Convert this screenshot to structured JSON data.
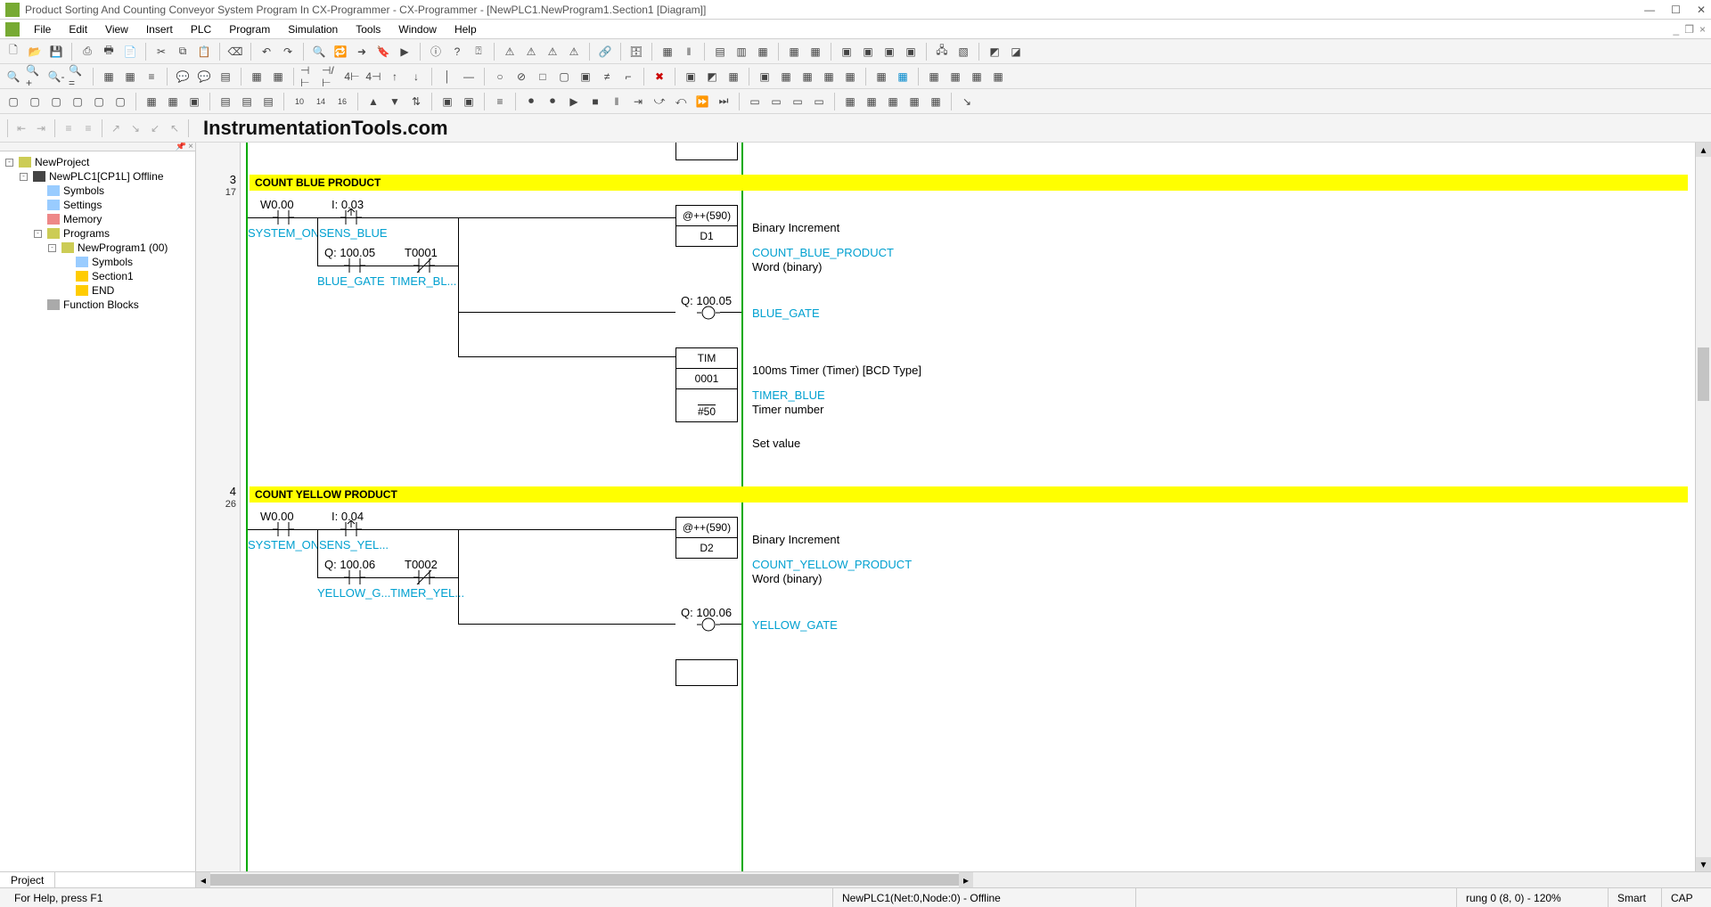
{
  "title": "Product Sorting And Counting Conveyor System Program In CX-Programmer - CX-Programmer - [NewPLC1.NewProgram1.Section1 [Diagram]]",
  "menu": {
    "file": "File",
    "edit": "Edit",
    "view": "View",
    "insert": "Insert",
    "plc": "PLC",
    "program": "Program",
    "simulation": "Simulation",
    "tools": "Tools",
    "window": "Window",
    "help": "Help"
  },
  "watermark": "InstrumentationTools.com",
  "tree": {
    "root": "NewProject",
    "plc": "NewPLC1[CP1L] Offline",
    "symbols": "Symbols",
    "settings": "Settings",
    "memory": "Memory",
    "programs": "Programs",
    "newprogram": "NewProgram1 (00)",
    "prog_symbols": "Symbols",
    "section1": "Section1",
    "end": "END",
    "fb": "Function Blocks"
  },
  "project_tab": "Project",
  "rownums": {
    "r3_big": "3",
    "r3_sm": "17",
    "r4_big": "4",
    "r4_sm": "26"
  },
  "rung3": {
    "title": "COUNT BLUE PRODUCT",
    "w000": "W0.00",
    "system_on": "SYSTEM_ON",
    "i003": "I: 0.03",
    "sens_blue": "SENS_BLUE",
    "q10005": "Q: 100.05",
    "blue_gate": "BLUE_GATE",
    "t0001": "T0001",
    "timer_bl": "TIMER_BL...",
    "inc": "@++(590)",
    "d1": "D1",
    "binc": "Binary Increment",
    "count_blue": "COUNT_BLUE_PRODUCT",
    "word": "Word (binary)",
    "q10005_2": "Q: 100.05",
    "blue_gate_2": "BLUE_GATE",
    "tim": "TIM",
    "t0001_2": "0001",
    "hash50": "#50",
    "timer100": "100ms Timer (Timer) [BCD Type]",
    "timer_blue": "TIMER_BLUE",
    "timer_num": "Timer number",
    "setval": "Set value"
  },
  "rung4": {
    "title": "COUNT YELLOW PRODUCT",
    "w000": "W0.00",
    "system_on": "SYSTEM_ON",
    "i004": "I: 0.04",
    "sens_yel": "SENS_YEL...",
    "q10006": "Q: 100.06",
    "yellow_g": "YELLOW_G...",
    "t0002": "T0002",
    "timer_yel": "TIMER_YEL...",
    "inc": "@++(590)",
    "d2": "D2",
    "binc": "Binary Increment",
    "count_yellow": "COUNT_YELLOW_PRODUCT",
    "word": "Word (binary)",
    "q10006_2": "Q: 100.06",
    "yellow_gate": "YELLOW_GATE"
  },
  "status": {
    "help": "For Help, press F1",
    "net": "NewPLC1(Net:0,Node:0) - Offline",
    "rung": "rung 0 (8, 0)  - 120%",
    "smart": "Smart",
    "cap": "CAP"
  }
}
